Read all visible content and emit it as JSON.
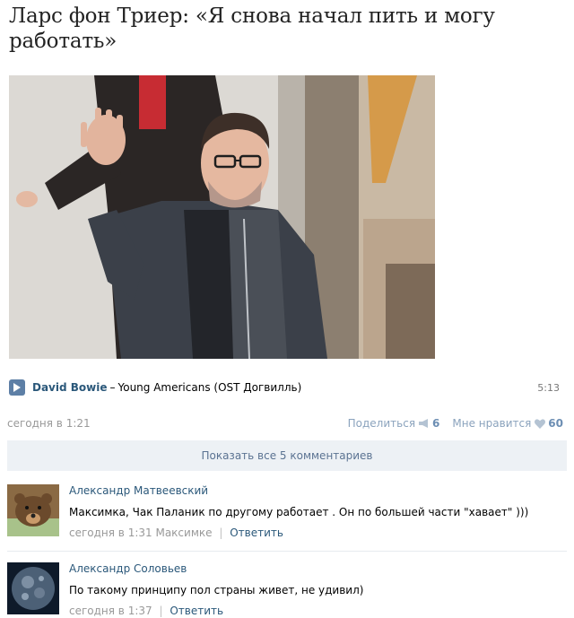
{
  "post": {
    "title": "Ларс фон Триер: «Я снова начал пить и могу работать»",
    "audio": {
      "artist": "David Bowie",
      "separator": "–",
      "title": "Young Americans (OST Догвилль)",
      "duration": "5:13"
    },
    "date": "сегодня в 1:21",
    "share_label": "Поделиться",
    "share_count": "6",
    "like_label": "Мне нравится",
    "like_count": "60"
  },
  "comments_toggle": "Показать все 5 комментариев",
  "comments": [
    {
      "author": "Александр Матвеевский",
      "text": "Максимка, Чак Паланик по другому работает . Он по большей части \"хавает\" )))",
      "date": "сегодня в 1:31",
      "reply_to": "Максимке",
      "separator": "|",
      "reply_label": "Ответить"
    },
    {
      "author": "Александр Соловьев",
      "text": "По такому принципу пол страны живет, не удивил)",
      "date": "сегодня в 1:37",
      "separator": "|",
      "reply_label": "Ответить"
    }
  ],
  "colors": {
    "link": "#2b587a",
    "muted": "#999999",
    "toggle_bg": "#edf1f5",
    "play_button": "#5d7fa6"
  },
  "icons": {
    "play": "play-icon",
    "share": "megaphone-icon",
    "like": "heart-icon"
  }
}
